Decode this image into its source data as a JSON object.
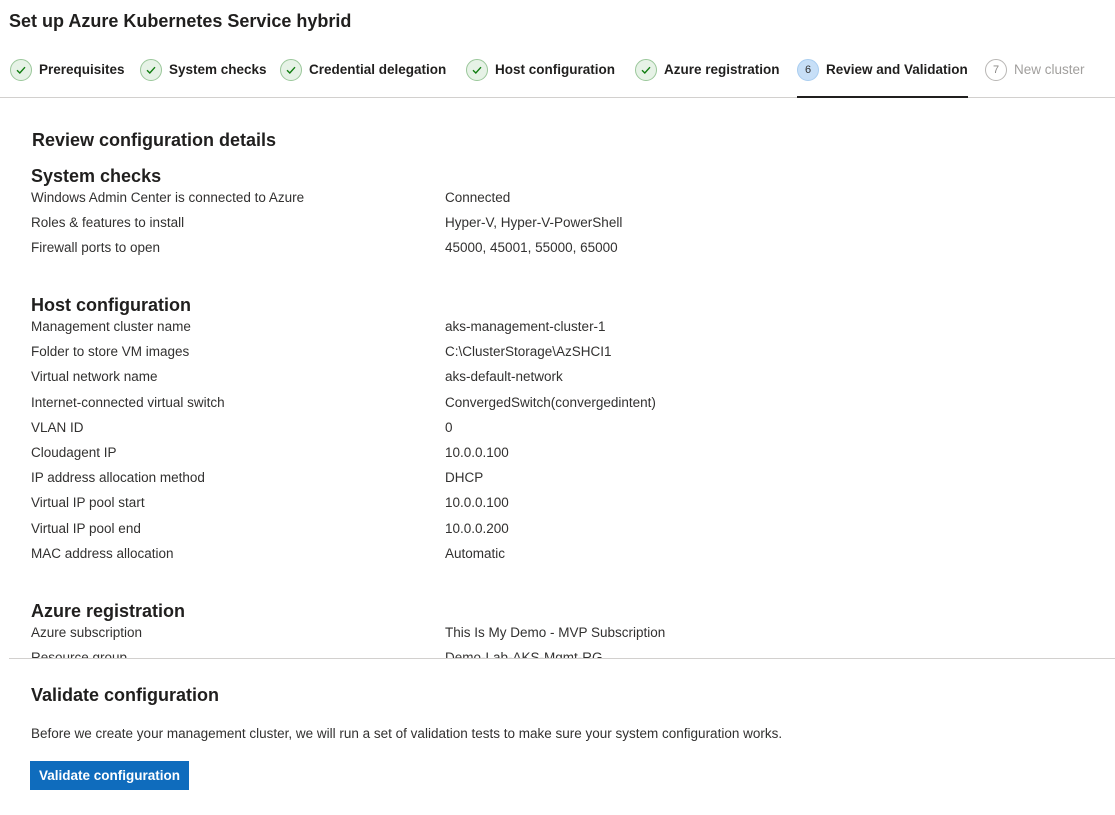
{
  "page": {
    "title": "Set up Azure Kubernetes Service hybrid"
  },
  "steps": [
    {
      "label": "Prerequisites",
      "state": "done",
      "icon": "checkmark-icon"
    },
    {
      "label": "System checks",
      "state": "done",
      "icon": "checkmark-icon"
    },
    {
      "label": "Credential delegation",
      "state": "done",
      "icon": "checkmark-icon"
    },
    {
      "label": "Host configuration",
      "state": "done",
      "icon": "checkmark-icon"
    },
    {
      "label": "Azure registration",
      "state": "done",
      "icon": "checkmark-icon"
    },
    {
      "number": "6",
      "label": "Review and Validation",
      "state": "current"
    },
    {
      "number": "7",
      "label": "New cluster",
      "state": "future"
    }
  ],
  "review": {
    "title": "Review configuration details",
    "system_checks": {
      "title": "System checks",
      "rows": [
        {
          "key": "Windows Admin Center is connected to Azure",
          "value": "Connected"
        },
        {
          "key": "Roles & features to install",
          "value": "Hyper-V, Hyper-V-PowerShell"
        },
        {
          "key": "Firewall ports to open",
          "value": "45000, 45001, 55000, 65000"
        }
      ]
    },
    "host_configuration": {
      "title": "Host configuration",
      "rows": [
        {
          "key": "Management cluster name",
          "value": "aks-management-cluster-1"
        },
        {
          "key": "Folder to store VM images",
          "value": "C:\\ClusterStorage\\AzSHCI1"
        },
        {
          "key": "Virtual network name",
          "value": "aks-default-network"
        },
        {
          "key": "Internet-connected virtual switch",
          "value": "ConvergedSwitch(convergedintent)"
        },
        {
          "key": "VLAN ID",
          "value": "0"
        },
        {
          "key": "Cloudagent IP",
          "value": "10.0.0.100"
        },
        {
          "key": "IP address allocation method",
          "value": "DHCP"
        },
        {
          "key": "Virtual IP pool start",
          "value": "10.0.0.100"
        },
        {
          "key": "Virtual IP pool end",
          "value": "10.0.0.200"
        },
        {
          "key": "MAC address allocation",
          "value": "Automatic"
        }
      ]
    },
    "azure_registration": {
      "title": "Azure registration",
      "rows": [
        {
          "key": "Azure subscription",
          "value": "This Is My Demo - MVP Subscription"
        },
        {
          "key": "Resource group",
          "value": "Demo-Lab-AKS-Mgmt-RG"
        }
      ]
    }
  },
  "validate": {
    "title": "Validate configuration",
    "description": "Before we create your management cluster, we will run a set of validation tests to make sure your system configuration works.",
    "button_label": "Validate configuration"
  },
  "colors": {
    "accent": "#0f6cbd",
    "success": "#107c10",
    "current_step": "#c7dff7"
  }
}
